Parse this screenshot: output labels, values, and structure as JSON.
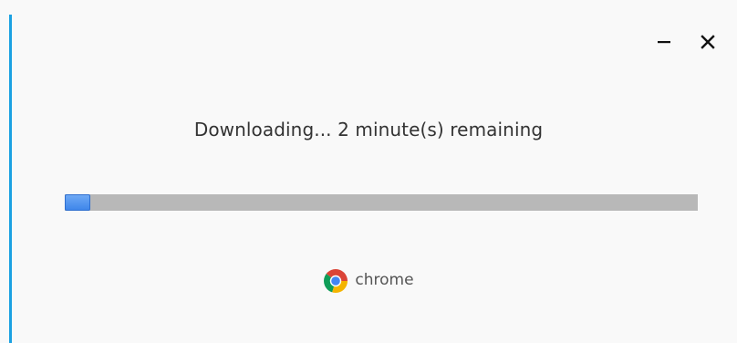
{
  "window": {
    "minimize_icon": "minimize-icon",
    "close_icon": "close-icon"
  },
  "status": {
    "text": "Downloading... 2 minute(s) remaining"
  },
  "progress": {
    "fraction": 0.04,
    "fill_color": "#4a8ef0",
    "track_color": "#b8b8b8"
  },
  "brand": {
    "logo_icon": "chrome-logo-icon",
    "name": "chrome"
  },
  "colors": {
    "accent": "#1ba1e2",
    "background": "#f9f9f9"
  }
}
